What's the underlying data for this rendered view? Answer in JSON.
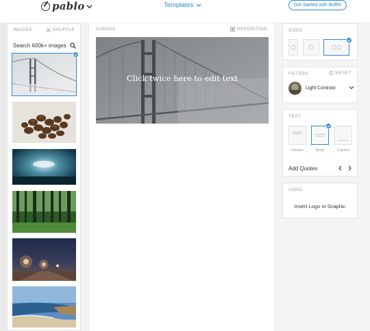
{
  "header": {
    "logo_text": "pablo",
    "templates_label": "Templates",
    "cta_label": "Get started with Buffer"
  },
  "images_panel": {
    "title": "IMAGES",
    "shuffle_label": "SHUFFLE",
    "search_placeholder": "Search 600k+ images",
    "thumbnails": [
      {
        "subject": "foggy bridge",
        "selected": true
      },
      {
        "subject": "coffee beans",
        "selected": false
      },
      {
        "subject": "stormy sky",
        "selected": false
      },
      {
        "subject": "forest",
        "selected": false
      },
      {
        "subject": "night street lights",
        "selected": false
      },
      {
        "subject": "beach coastline",
        "selected": false
      }
    ]
  },
  "canvas": {
    "title": "CANVAS",
    "reposition_label": "REPOSITION",
    "overlay_text": "Click twice here to edit text"
  },
  "sizes_panel": {
    "title": "SIZES",
    "selected_index": 2
  },
  "filters_panel": {
    "title": "FILTERS",
    "reset_label": "RESET",
    "selected_filter": "Light Contrast"
  },
  "text_panel": {
    "title": "TEXT",
    "options": [
      "Header",
      "Body",
      "Caption"
    ],
    "selected_index": 1,
    "add_quotes_label": "Add Quotes"
  },
  "logo_panel": {
    "title": "LOGO",
    "insert_label": "Insert Logo or Graphic"
  },
  "colors": {
    "accent": "#2c87d6"
  }
}
